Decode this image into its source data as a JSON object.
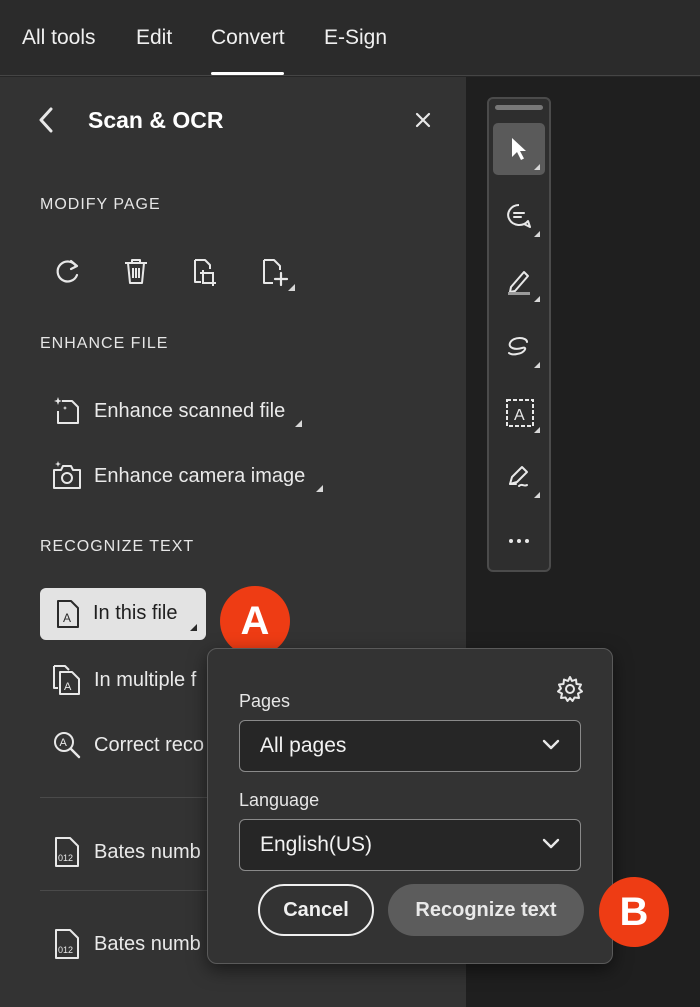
{
  "topbar": {
    "tabs": [
      {
        "label": "All tools"
      },
      {
        "label": "Edit"
      },
      {
        "label": "Convert",
        "active": true
      },
      {
        "label": "E-Sign"
      }
    ]
  },
  "panel": {
    "title": "Scan & OCR",
    "back_icon": "chevron-left-icon",
    "close_icon": "close-icon",
    "modify_page": {
      "heading": "MODIFY PAGE",
      "icons": [
        "rotate-icon",
        "delete-icon",
        "crop-page-icon",
        "insert-page-icon"
      ]
    },
    "enhance_file": {
      "heading": "ENHANCE FILE",
      "items": [
        {
          "label": "Enhance scanned file",
          "icon": "enhance-scan-icon"
        },
        {
          "label": "Enhance camera image",
          "icon": "enhance-camera-icon"
        }
      ]
    },
    "recognize_text": {
      "heading": "RECOGNIZE TEXT",
      "items": [
        {
          "label": "In this file",
          "icon": "text-file-icon",
          "selected": true
        },
        {
          "label": "In multiple f",
          "icon": "multiple-files-icon"
        },
        {
          "label": "Correct reco",
          "icon": "correct-text-icon"
        }
      ]
    },
    "bates": [
      {
        "label": "Bates numb",
        "icon": "bates-number-icon"
      },
      {
        "label": "Bates numb",
        "icon": "bates-number-icon"
      }
    ]
  },
  "badges": {
    "a": "A",
    "b": "B",
    "color": "#ee3c14"
  },
  "toolbar": {
    "tools": [
      "select-pointer-icon",
      "comment-icon",
      "highlight-icon",
      "draw-lasso-icon",
      "text-select-icon",
      "sign-icon",
      "more-icon"
    ]
  },
  "popover": {
    "settings_icon": "gear-icon",
    "pages_label": "Pages",
    "pages_value": "All pages",
    "language_label": "Language",
    "language_value": "English(US)",
    "cancel_label": "Cancel",
    "recognize_label": "Recognize text"
  }
}
